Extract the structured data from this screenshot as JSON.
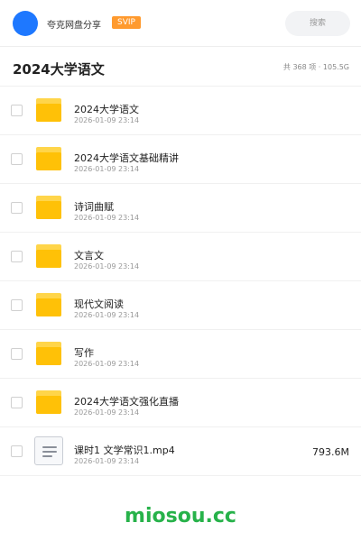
{
  "topbar": {
    "username": "夸克网盘分享",
    "vip_badge": "SVIP",
    "search_placeholder": "搜索",
    "avatar_color": "#1e78ff"
  },
  "header": {
    "title": "2024大学语文",
    "summary": "共 368 项 · 105.5G"
  },
  "items": [
    {
      "type": "folder",
      "name": "2024大学语文",
      "date": "2026-01-09 23:14",
      "size": ""
    },
    {
      "type": "folder",
      "name": "2024大学语文基础精讲",
      "date": "2026-01-09 23:14",
      "size": ""
    },
    {
      "type": "folder",
      "name": "诗词曲赋",
      "date": "2026-01-09 23:14",
      "size": ""
    },
    {
      "type": "folder",
      "name": "文言文",
      "date": "2026-01-09 23:14",
      "size": ""
    },
    {
      "type": "folder",
      "name": "现代文阅读",
      "date": "2026-01-09 23:14",
      "size": ""
    },
    {
      "type": "folder",
      "name": "写作",
      "date": "2026-01-09 23:14",
      "size": ""
    },
    {
      "type": "folder",
      "name": "2024大学语文强化直播",
      "date": "2026-01-09 23:14",
      "size": ""
    },
    {
      "type": "file",
      "name": "课时1   文学常识1.mp4",
      "date": "2026-01-09 23:14",
      "size": "793.6M"
    }
  ],
  "footer": {
    "watermark": "miosou.cc"
  },
  "colors": {
    "folder": "#ffc107",
    "vip": "#ff9a2e",
    "watermark": "#27b24a"
  }
}
